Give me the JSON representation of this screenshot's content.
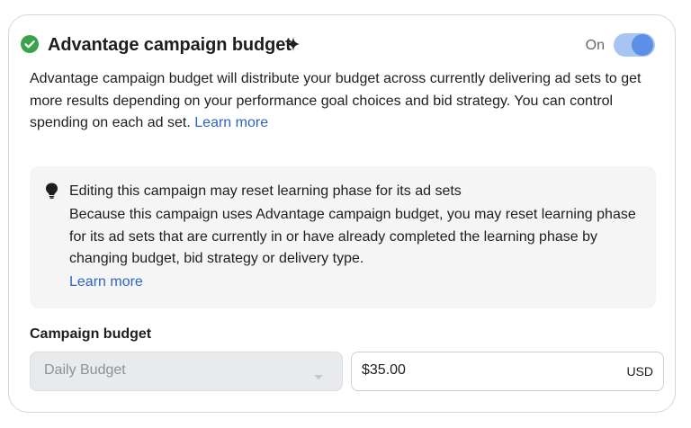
{
  "header": {
    "title": "Advantage campaign budget",
    "status_icon": "check-circle-icon",
    "title_icon": "sparkle-icon",
    "toggle_label": "On",
    "toggle_state": "on"
  },
  "description": {
    "text": "Advantage campaign budget will distribute your budget across currently delivering ad sets to get more results depending on your performance goal choices and bid strategy. You can control spending on each ad set.",
    "link": "Learn more"
  },
  "notice": {
    "icon": "lightbulb-icon",
    "title": "Editing this campaign may reset learning phase for its ad sets",
    "body": "Because this campaign uses Advantage campaign budget, you may reset learning phase for its ad sets that are currently in or have already completed the learning phase by changing budget, bid strategy or delivery type.",
    "link": "Learn more"
  },
  "budget": {
    "label": "Campaign budget",
    "type_selected": "Daily Budget",
    "amount": "$35.00",
    "currency": "USD"
  },
  "colors": {
    "accent": "#2d64c8",
    "success": "#3aa34a",
    "toggle_track": "#a8c4f2",
    "toggle_knob": "#5b8fe8"
  }
}
